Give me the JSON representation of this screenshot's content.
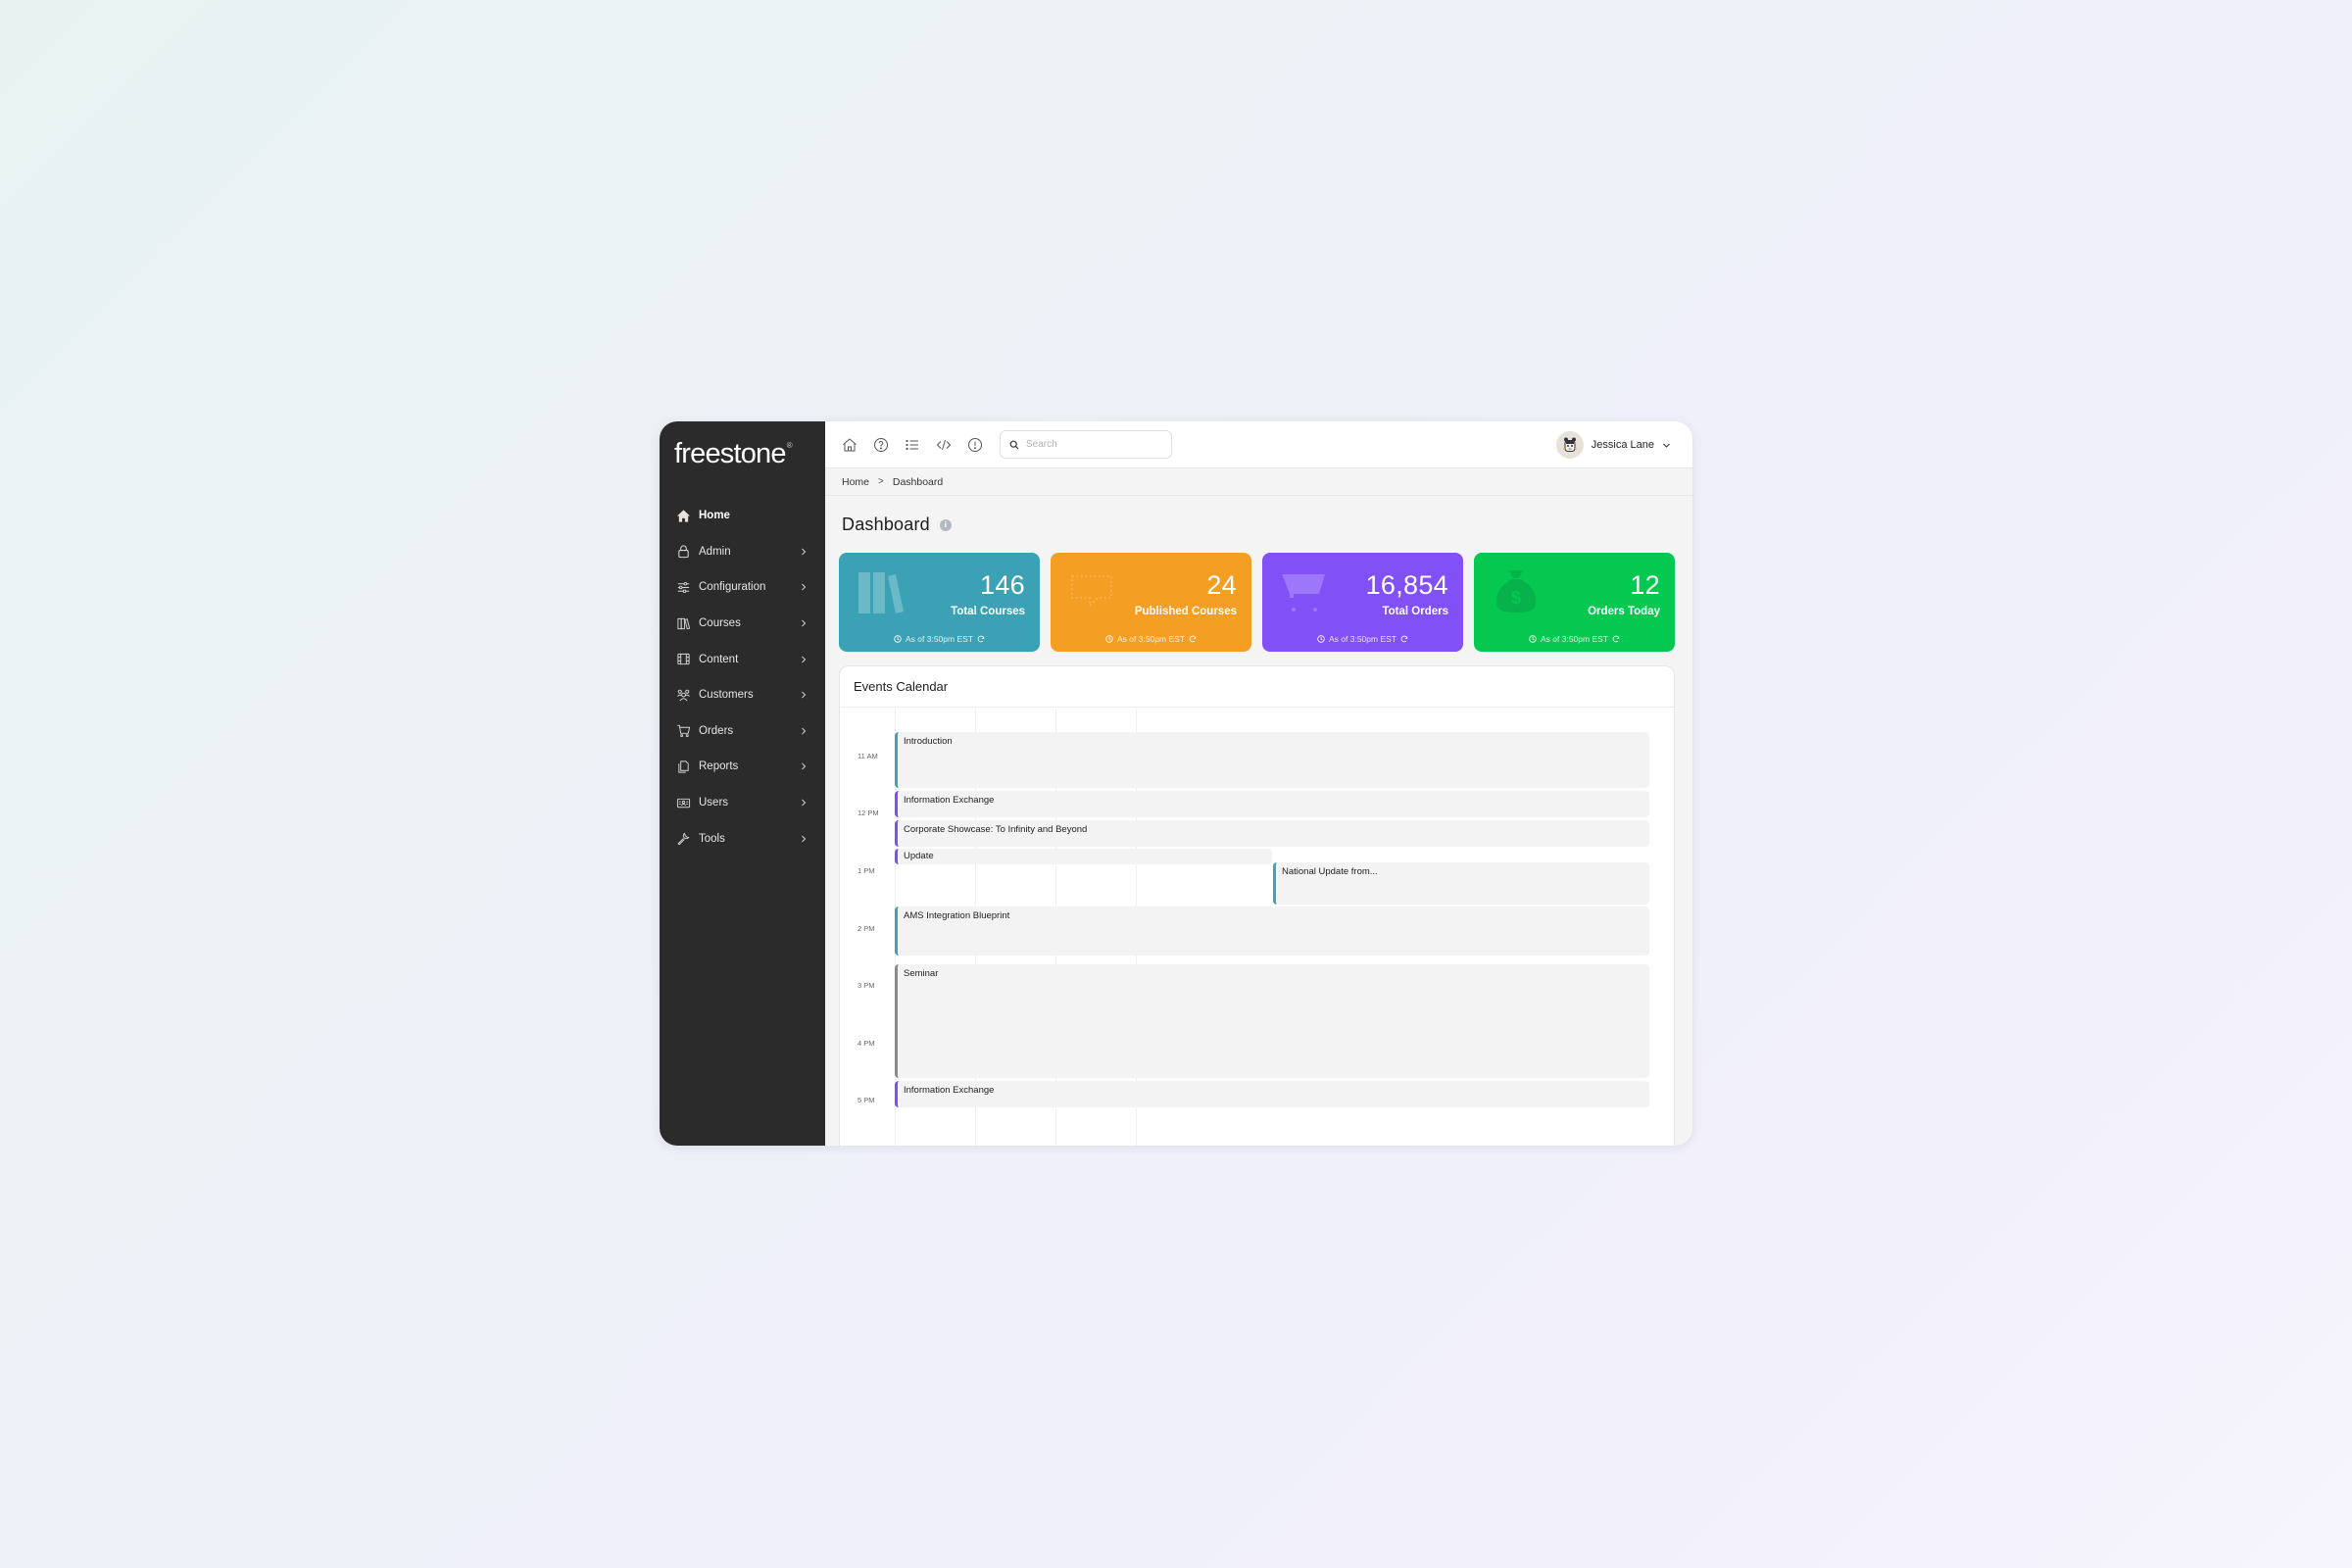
{
  "brand": {
    "name": "freestone",
    "mark": "®"
  },
  "sidebar": {
    "items": [
      {
        "label": "Home",
        "icon": "home-icon",
        "active": true
      },
      {
        "label": "Admin",
        "icon": "lock-icon"
      },
      {
        "label": "Configuration",
        "icon": "sliders-icon"
      },
      {
        "label": "Courses",
        "icon": "books-icon"
      },
      {
        "label": "Content",
        "icon": "film-icon"
      },
      {
        "label": "Customers",
        "icon": "users-group-icon"
      },
      {
        "label": "Orders",
        "icon": "cart-icon"
      },
      {
        "label": "Reports",
        "icon": "document-icon"
      },
      {
        "label": "Users",
        "icon": "id-card-icon"
      },
      {
        "label": "Tools",
        "icon": "wrench-icon"
      }
    ]
  },
  "topbar": {
    "icons": [
      "home-icon",
      "help-icon",
      "list-icon",
      "code-icon",
      "alert-icon"
    ],
    "search": {
      "placeholder": "Search",
      "value": ""
    },
    "user": {
      "name": "Jessica Lane"
    }
  },
  "breadcrumb": {
    "items": [
      "Home",
      "Dashboard"
    ],
    "separator": ">"
  },
  "page": {
    "title": "Dashboard"
  },
  "cards": [
    {
      "value": "146",
      "label": "Total Courses",
      "asof": "As of 3:50pm EST",
      "color": "#3ba2b5",
      "icon": "books-icon"
    },
    {
      "value": "24",
      "label": "Published Courses",
      "asof": "As of 3:50pm EST",
      "color": "#f59e24",
      "icon": "chat-bubble-icon"
    },
    {
      "value": "16,854",
      "label": "Total Orders",
      "asof": "As of 3:50pm EST",
      "color": "#8150f7",
      "icon": "cart-icon"
    },
    {
      "value": "12",
      "label": "Orders Today",
      "asof": "As of 3:50pm EST",
      "color": "#05c851",
      "icon": "money-bag-icon"
    }
  ],
  "calendar": {
    "title": "Events Calendar",
    "hours": [
      "11 AM",
      "12 PM",
      "1 PM",
      "2 PM",
      "3 PM",
      "4 PM",
      "5 PM"
    ],
    "events": [
      {
        "title": "Introduction",
        "color": "#40a3b3"
      },
      {
        "title": "Information Exchange",
        "color": "#7c4ff0"
      },
      {
        "title": "Corporate Showcase: To Infinity and Beyond",
        "color": "#7c4ff0"
      },
      {
        "title": "Update",
        "color": "#7c4ff0"
      },
      {
        "title": "National Update from...",
        "color": "#40a3b3"
      },
      {
        "title": "AMS Integration Blueprint",
        "color": "#40a3b3"
      },
      {
        "title": "Seminar",
        "color": "#8a8a8a"
      },
      {
        "title": "Information Exchange",
        "color": "#7c4ff0"
      }
    ]
  }
}
